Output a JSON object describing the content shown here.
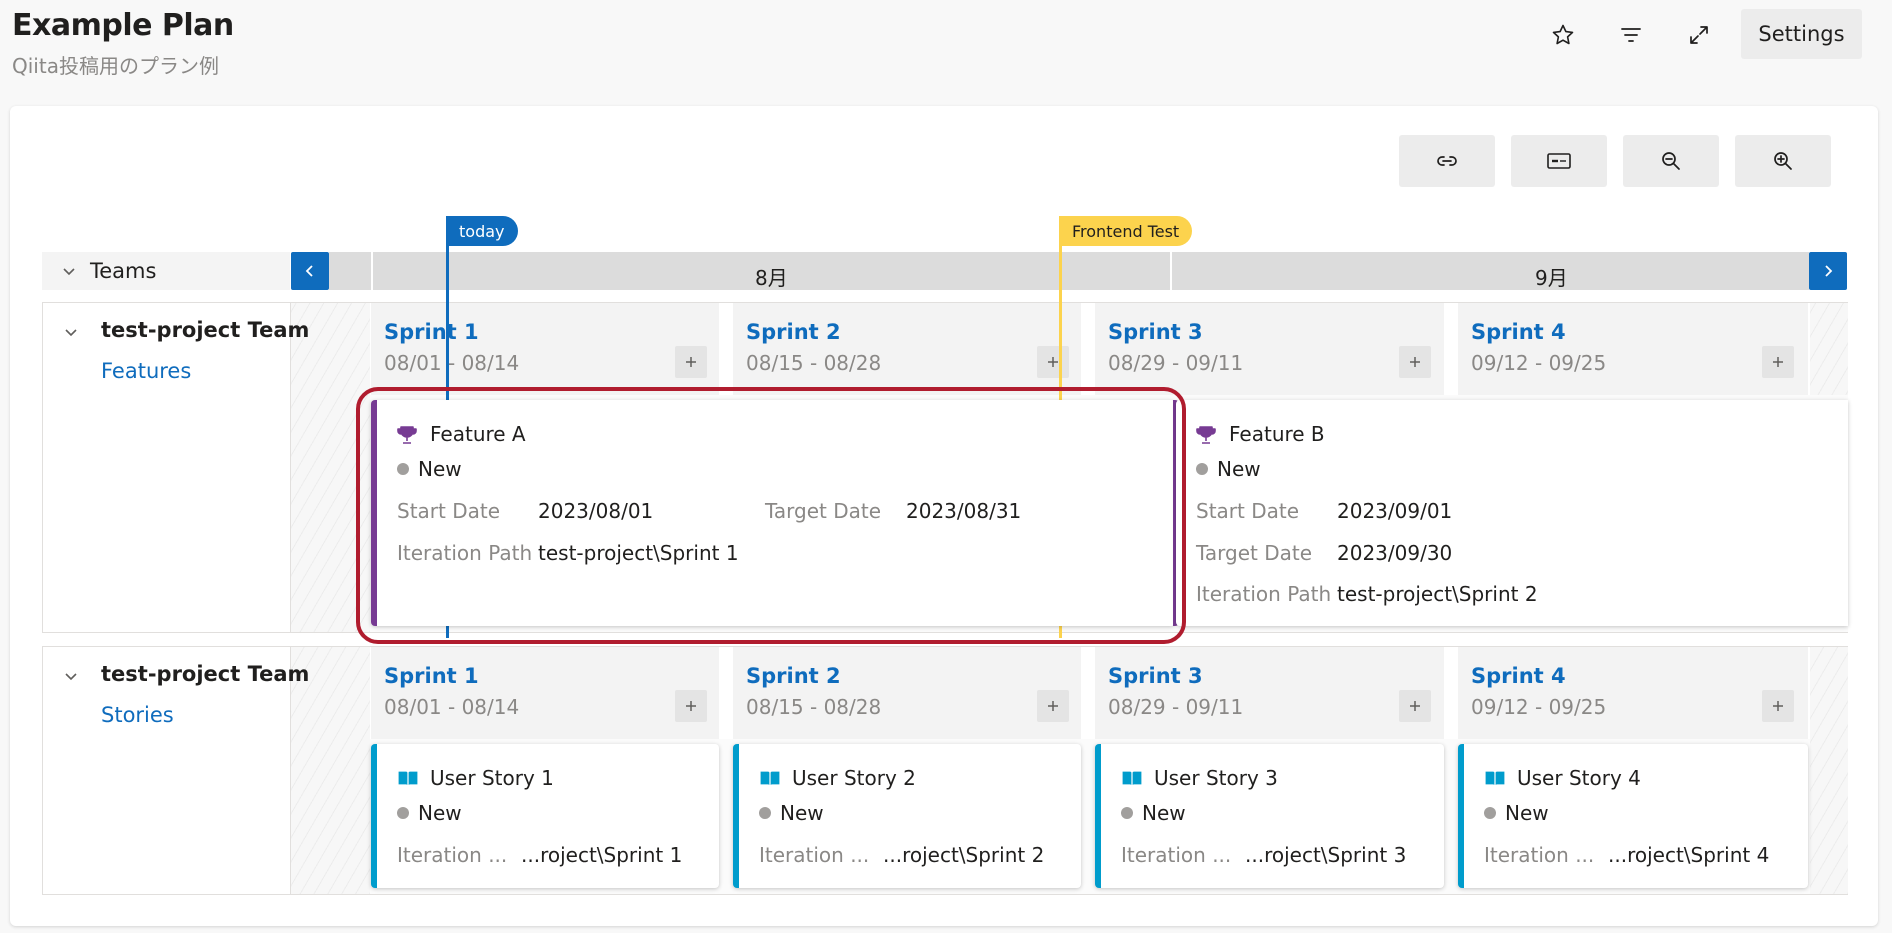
{
  "header": {
    "title": "Example Plan",
    "subtitle": "Qiita投稿用のプラン例",
    "settings_label": "Settings",
    "icons": [
      "star-icon",
      "filter-icon",
      "expand-icon"
    ]
  },
  "toolbar": {
    "icons": [
      "link-icon",
      "card-fields-icon",
      "zoom-out-icon",
      "zoom-in-icon"
    ]
  },
  "markers": {
    "today": {
      "label": "today",
      "color": "#0f6cbd"
    },
    "frontend_test": {
      "label": "Frontend Test",
      "color": "#fcd34d"
    }
  },
  "timeline": {
    "teams_label": "Teams",
    "months": [
      "8月",
      "9月"
    ]
  },
  "rows": [
    {
      "team": "test-project Team",
      "backlog": "Features",
      "sprints": [
        {
          "name": "Sprint 1",
          "dates": "08/01 - 08/14"
        },
        {
          "name": "Sprint 2",
          "dates": "08/15 - 08/28"
        },
        {
          "name": "Sprint 3",
          "dates": "08/29 - 09/11"
        },
        {
          "name": "Sprint 4",
          "dates": "09/12 - 09/25"
        }
      ],
      "cards": [
        {
          "title": "Feature A",
          "state": "New",
          "start_label": "Start Date",
          "start": "2023/08/01",
          "target_label": "Target Date",
          "target": "2023/08/31",
          "iter_label": "Iteration Path",
          "iter": "test-project\\Sprint 1"
        },
        {
          "title": "Feature B",
          "state": "New",
          "start_label": "Start Date",
          "start": "2023/09/01",
          "target_label": "Target Date",
          "target": "2023/09/30",
          "iter_label": "Iteration Path",
          "iter": "test-project\\Sprint 2"
        }
      ]
    },
    {
      "team": "test-project Team",
      "backlog": "Stories",
      "sprints": [
        {
          "name": "Sprint 1",
          "dates": "08/01 - 08/14"
        },
        {
          "name": "Sprint 2",
          "dates": "08/15 - 08/28"
        },
        {
          "name": "Sprint 3",
          "dates": "08/29 - 09/11"
        },
        {
          "name": "Sprint 4",
          "dates": "09/12 - 09/25"
        }
      ],
      "stories": [
        {
          "title": "User Story 1",
          "state": "New",
          "iter_label": "Iteration ...",
          "iter": "...roject\\Sprint 1"
        },
        {
          "title": "User Story 2",
          "state": "New",
          "iter_label": "Iteration ...",
          "iter": "...roject\\Sprint 2"
        },
        {
          "title": "User Story 3",
          "state": "New",
          "iter_label": "Iteration ...",
          "iter": "...roject\\Sprint 3"
        },
        {
          "title": "User Story 4",
          "state": "New",
          "iter_label": "Iteration ...",
          "iter": "...roject\\Sprint 4"
        }
      ]
    }
  ],
  "colors": {
    "accent": "#0f6cbd",
    "feature": "#773b93",
    "story": "#009ccc",
    "highlight": "#b01c2e",
    "state_new": "#a19f9d"
  }
}
